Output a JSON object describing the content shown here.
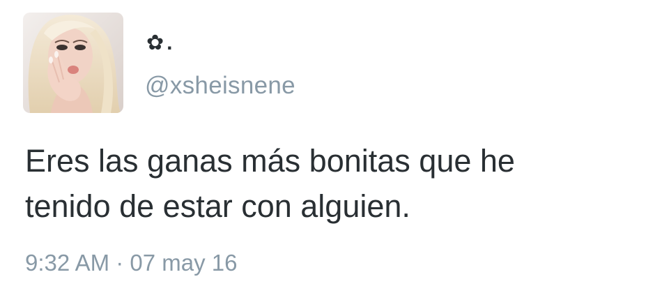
{
  "user": {
    "display_name_icon": "flower-icon",
    "display_name_glyph": "✿",
    "display_name_suffix": ".",
    "handle": "@xsheisnene"
  },
  "tweet": {
    "line1": "Eres las ganas más bonitas que he",
    "line2": "tenido de estar con alguien.",
    "timestamp": "9:32 AM · 07 may 16"
  },
  "colors": {
    "text": "#292f33",
    "secondary": "#8899a6",
    "background": "#ffffff"
  }
}
